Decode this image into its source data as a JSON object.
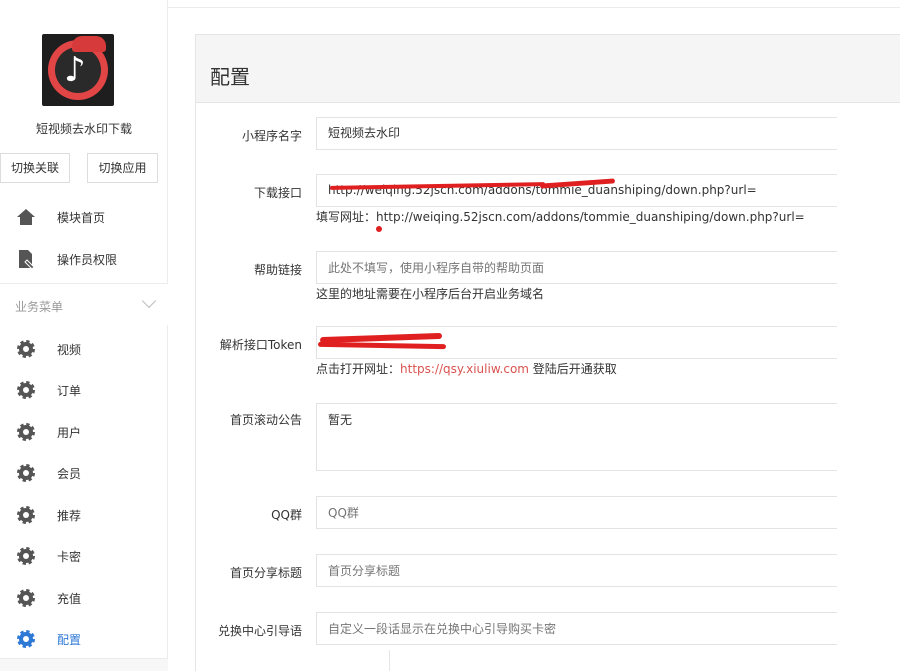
{
  "app": {
    "name": "短视频去水印下载"
  },
  "sidebar": {
    "switch_link": "切换关联",
    "switch_app": "切换应用",
    "top_items": [
      {
        "label": "模块首页",
        "icon": "home-icon"
      },
      {
        "label": "操作员权限",
        "icon": "document-icon"
      }
    ],
    "group_label": "业务菜单",
    "items": [
      {
        "label": "视频",
        "icon": "gear-icon"
      },
      {
        "label": "订单",
        "icon": "gear-icon"
      },
      {
        "label": "用户",
        "icon": "gear-icon"
      },
      {
        "label": "会员",
        "icon": "gear-icon"
      },
      {
        "label": "推荐",
        "icon": "gear-icon"
      },
      {
        "label": "卡密",
        "icon": "gear-icon"
      },
      {
        "label": "充值",
        "icon": "gear-icon"
      },
      {
        "label": "配置",
        "icon": "gear-icon",
        "active": true
      }
    ]
  },
  "panel": {
    "title": "配置",
    "fields": {
      "mini_name": {
        "label": "小程序名字",
        "value": "短视频去水印"
      },
      "download_api": {
        "label": "下载接口",
        "value": "http://weiqing.52jscn.com/addons/tommie_duanshiping/down.php?url=",
        "hint": "填写网址：http://weiqing.52jscn.com/addons/tommie_duanshiping/down.php?url="
      },
      "help_link": {
        "label": "帮助链接",
        "placeholder": "此处不填写，使用小程序自带的帮助页面",
        "hint": "这里的地址需要在小程序后台开启业务域名"
      },
      "parse_token": {
        "label": "解析接口Token",
        "value": "",
        "hint_prefix": "点击打开网址：",
        "hint_link": "https://qsy.xiuliw.com",
        "hint_suffix": " 登陆后开通获取"
      },
      "notice": {
        "label": "首页滚动公告",
        "value": "暂无"
      },
      "qq_group": {
        "label": "QQ群",
        "placeholder": "QQ群"
      },
      "share_title": {
        "label": "首页分享标题",
        "placeholder": "首页分享标题"
      },
      "exchange_guide": {
        "label": "兑换中心引导语",
        "placeholder": "自定义一段话显示在兑换中心引导购买卡密"
      }
    }
  },
  "colors": {
    "accent": "#2e78d6",
    "link": "#d9534f",
    "redact": "#e02020"
  }
}
